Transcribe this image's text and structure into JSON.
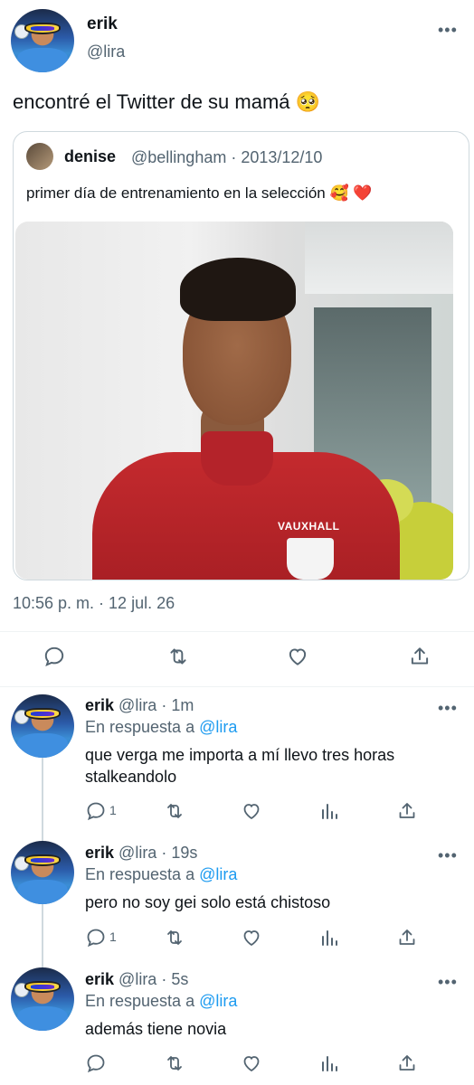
{
  "main_tweet": {
    "display_name": "erik",
    "handle": "@lira",
    "text": "encontré el Twitter de su mamá 🥺",
    "timestamp": "10:56 p. m. · 12 jul. 26"
  },
  "quoted_tweet": {
    "display_name": "denise",
    "handle": "@bellingham",
    "date": "· 2013/12/10",
    "text": "primer día de entrenamiento en la selección 🥰 ❤️",
    "shirt_sponsor": "VAUXHALL"
  },
  "replies": [
    {
      "display_name": "erik",
      "handle": "@lira",
      "time": "· 1m",
      "reply_prefix": "En respuesta a",
      "reply_to": "@lira",
      "text": "que verga me importa a mí llevo tres horas stalkeandolo",
      "reply_count": "1"
    },
    {
      "display_name": "erik",
      "handle": "@lira",
      "time": "· 19s",
      "reply_prefix": "En respuesta a",
      "reply_to": "@lira",
      "text": "pero no soy gei solo está chistoso",
      "reply_count": "1"
    },
    {
      "display_name": "erik",
      "handle": "@lira",
      "time": "· 5s",
      "reply_prefix": "En respuesta a",
      "reply_to": "@lira",
      "text": "además tiene novia",
      "reply_count": ""
    }
  ],
  "colors": {
    "accent": "#1d9bf0",
    "muted_text": "#536471",
    "divider": "#eff3f4"
  },
  "icons": [
    "reply-icon",
    "retweet-icon",
    "like-icon",
    "views-icon",
    "share-icon",
    "more-icon"
  ]
}
